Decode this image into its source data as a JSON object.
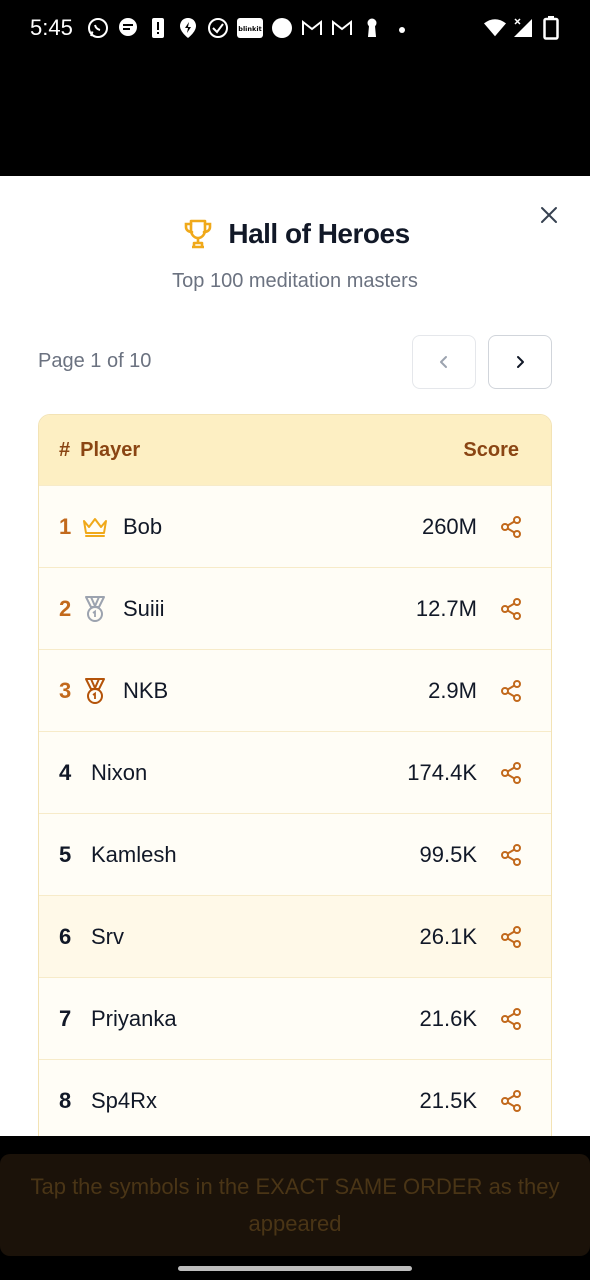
{
  "status": {
    "time": "5:45",
    "icons": [
      "whatsapp-icon",
      "chat-icon",
      "alert-icon",
      "location-icon",
      "check-circle-icon",
      "blinkit-icon",
      "dot-icon",
      "gmail-icon",
      "gmail-icon",
      "keyhole-icon",
      "small-dot-icon"
    ],
    "blinkit_text": "blinkit",
    "right_icons": [
      "wifi-icon",
      "signal-icon",
      "battery-icon"
    ]
  },
  "modal": {
    "title": "Hall of Heroes",
    "subtitle": "Top 100 meditation masters",
    "page_label": "Page 1 of 10",
    "header": {
      "hash": "#",
      "player": "Player",
      "score": "Score"
    },
    "rows": [
      {
        "rank": "1",
        "name": "Bob",
        "score": "260M",
        "badge": "crown-icon"
      },
      {
        "rank": "2",
        "name": "Suiii",
        "score": "12.7M",
        "badge": "silver-medal-icon"
      },
      {
        "rank": "3",
        "name": "NKB",
        "score": "2.9M",
        "badge": "bronze-medal-icon"
      },
      {
        "rank": "4",
        "name": "Nixon",
        "score": "174.4K"
      },
      {
        "rank": "5",
        "name": "Kamlesh",
        "score": "99.5K"
      },
      {
        "rank": "6",
        "name": "Srv",
        "score": "26.1K"
      },
      {
        "rank": "7",
        "name": "Priyanka",
        "score": "21.6K"
      },
      {
        "rank": "8",
        "name": "Sp4Rx",
        "score": "21.5K"
      }
    ]
  },
  "toast": {
    "text": "Tap the symbols in the EXACT SAME ORDER as they appeared"
  },
  "colors": {
    "accent": "#f0a91a",
    "header_text": "#8a4513",
    "rank_top": "#c2691c"
  }
}
